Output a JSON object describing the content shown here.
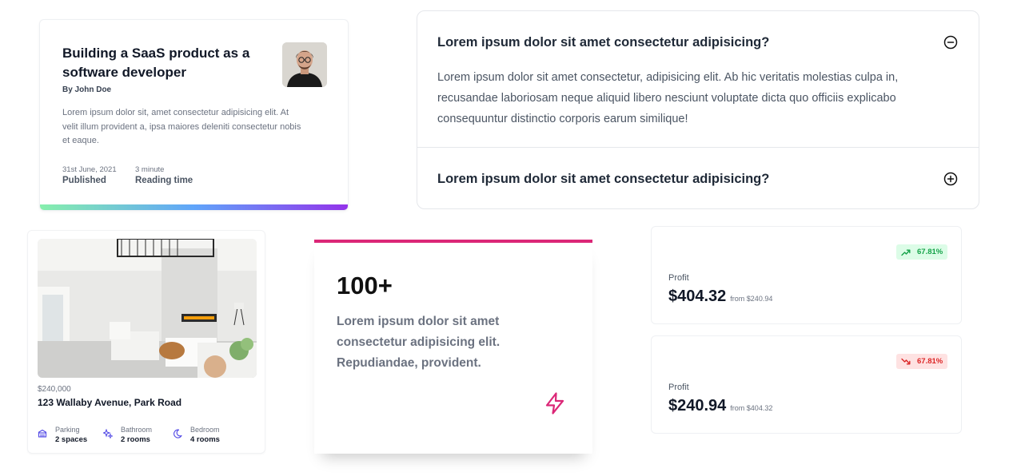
{
  "blog": {
    "title": "Building a SaaS product as a software developer",
    "author": "By John Doe",
    "excerpt": "Lorem ipsum dolor sit, amet consectetur adipisicing elit. At velit illum provident a, ipsa maiores deleniti consectetur nobis et eaque.",
    "meta": [
      {
        "value": "31st June, 2021",
        "label": "Published"
      },
      {
        "value": "3 minute",
        "label": "Reading time"
      }
    ],
    "gradient_colors": [
      "#86efac",
      "#60a5fa",
      "#9333ea"
    ]
  },
  "faq": {
    "items": [
      {
        "question": "Lorem ipsum dolor sit amet consectetur adipisicing?",
        "answer": "Lorem ipsum dolor sit amet consectetur, adipisicing elit. Ab hic veritatis molestias culpa in, recusandae laboriosam neque aliquid libero nesciunt voluptate dicta quo officiis explicabo consequuntur distinctio corporis earum similique!",
        "expanded": true,
        "icon": "minus-circle-icon"
      },
      {
        "question": "Lorem ipsum dolor sit amet consectetur adipisicing?",
        "expanded": false,
        "icon": "plus-circle-icon"
      }
    ]
  },
  "property": {
    "price": "$240,000",
    "address": "123 Wallaby Avenue, Park Road",
    "features": [
      {
        "label": "Parking",
        "value": "2 spaces",
        "icon": "parking-icon"
      },
      {
        "label": "Bathroom",
        "value": "2 rooms",
        "icon": "sparkle-icon"
      },
      {
        "label": "Bedroom",
        "value": "4 rooms",
        "icon": "moon-icon"
      }
    ],
    "accent_color": "#4f46e5"
  },
  "stat": {
    "number": "100+",
    "description": "Lorem ipsum dolor sit amet consectetur adipisicing elit. Repudiandae, provident.",
    "accent_color": "#db2777",
    "icon": "lightning-icon"
  },
  "profits": [
    {
      "label": "Profit",
      "value": "$404.32",
      "from": "from $240.94",
      "change": "67.81%",
      "trend": "up"
    },
    {
      "label": "Profit",
      "value": "$240.94",
      "from": "from $404.32",
      "change": "67.81%",
      "trend": "down"
    }
  ]
}
